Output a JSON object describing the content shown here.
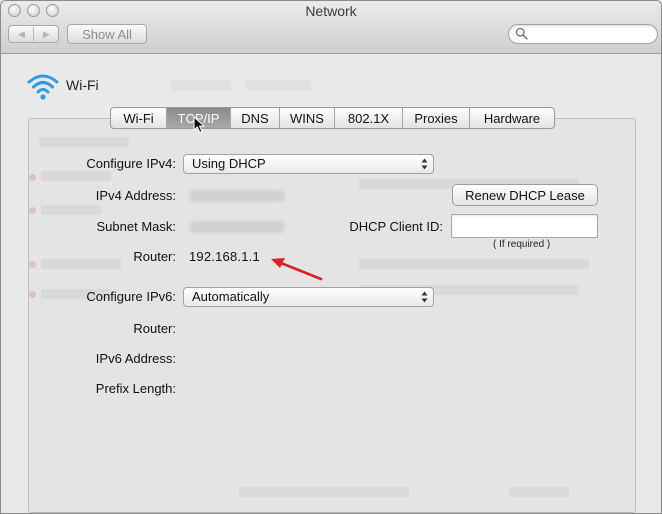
{
  "window": {
    "title": "Network"
  },
  "toolbar": {
    "back_icon": "◀",
    "forward_icon": "▶",
    "show_all_label": "Show All",
    "search_placeholder": ""
  },
  "interface": {
    "name": "Wi-Fi"
  },
  "tabs": [
    {
      "label": "Wi-Fi",
      "selected": false
    },
    {
      "label": "TCP/IP",
      "selected": true
    },
    {
      "label": "DNS",
      "selected": false
    },
    {
      "label": "WINS",
      "selected": false
    },
    {
      "label": "802.1X",
      "selected": false
    },
    {
      "label": "Proxies",
      "selected": false
    },
    {
      "label": "Hardware",
      "selected": false
    }
  ],
  "ipv4": {
    "configure_label": "Configure IPv4:",
    "configure_value": "Using DHCP",
    "address_label": "IPv4 Address:",
    "subnet_label": "Subnet Mask:",
    "router_label": "Router:",
    "router_value": "192.168.1.1",
    "renew_button": "Renew DHCP Lease",
    "client_id_label": "DHCP Client ID:",
    "client_id_value": "",
    "client_id_hint": "( If required )"
  },
  "ipv6": {
    "configure_label": "Configure IPv6:",
    "configure_value": "Automatically",
    "router_label": "Router:",
    "address_label": "IPv6 Address:",
    "prefix_label": "Prefix Length:"
  },
  "colors": {
    "annotation_arrow": "#e02020",
    "selected_tab": "#9a9a9a"
  }
}
